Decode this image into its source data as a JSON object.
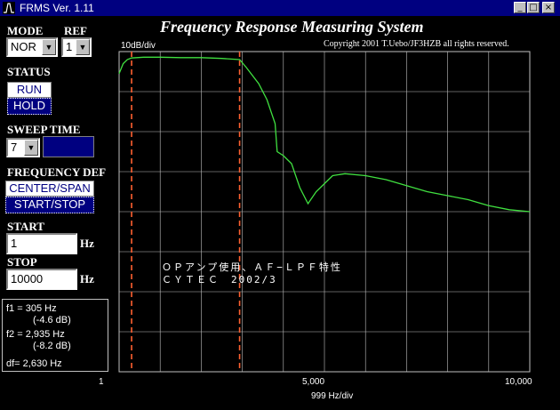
{
  "window": {
    "title": "FRMS Ver. 1.11",
    "controls": [
      "minimize-icon",
      "maximize-icon",
      "close-icon"
    ]
  },
  "header": {
    "title": "Frequency Response Measuring System",
    "copyright": "Copyright 2001 T.Uebo/JF3HZB all rights reserved."
  },
  "controls": {
    "mode_label": "MODE",
    "mode_value": "NOR",
    "ref_label": "REF",
    "ref_value": "1",
    "status_label": "STATUS",
    "run_label": "RUN",
    "hold_label": "HOLD",
    "sweep_label": "SWEEP TIME",
    "sweep_value": "7",
    "freqdef_label": "FREQUENCY DEF",
    "center_span_label": "CENTER/SPAN",
    "start_stop_label": "START/STOP",
    "start_label": "START",
    "start_value": "1",
    "stop_label": "STOP",
    "stop_value": "10000",
    "hz_unit": "Hz"
  },
  "markers": {
    "f1_line": "f1 = 305 Hz",
    "f1_db": "(-4.6 dB)",
    "f2_line": "f2 = 2,935 Hz",
    "f2_db": "(-8.2 dB)",
    "df_line": "df= 2,630 Hz"
  },
  "plot": {
    "y_scale": "10dB/div",
    "x_scale": "999 Hz/div",
    "x_ticks": [
      "1",
      "5,000",
      "10,000"
    ],
    "annotation_line1": "ＯＰアンプ使用、ＡＦ−ＬＰＦ特性",
    "annotation_line2": "ＣＹＴＥＣ　2002/3",
    "trace_color": "#40e040",
    "grid_color": "#c0c0c0",
    "marker_color": "#ff6030"
  },
  "chart_data": {
    "type": "line",
    "xlabel": "999 Hz/div",
    "ylabel": "10dB/div",
    "xlim": [
      1,
      10000
    ],
    "ylim": [
      -80,
      0
    ],
    "markers": [
      305,
      2935
    ],
    "series": [
      {
        "x": [
          1,
          100,
          200,
          305,
          600,
          1000,
          1500,
          2000,
          2500,
          2935,
          3100,
          3400,
          3600,
          3800,
          3850,
          4000,
          4200,
          4400,
          4600,
          4800,
          5000,
          5200,
          5500,
          6000,
          6500,
          7000,
          7500,
          8000,
          8500,
          9000,
          9500,
          10000
        ],
        "y": [
          -5.5,
          -3.0,
          -2.0,
          -1.6,
          -1.4,
          -1.4,
          -1.5,
          -1.5,
          -1.7,
          -2.0,
          -4.0,
          -8.0,
          -12.0,
          -18.0,
          -25.0,
          -26.0,
          -28.0,
          -34.0,
          -38.0,
          -35.0,
          -33.0,
          -31.0,
          -30.5,
          -31.0,
          -32.0,
          -33.5,
          -35.0,
          -36.0,
          -37.0,
          -38.5,
          -39.5,
          -40.0
        ]
      }
    ]
  }
}
